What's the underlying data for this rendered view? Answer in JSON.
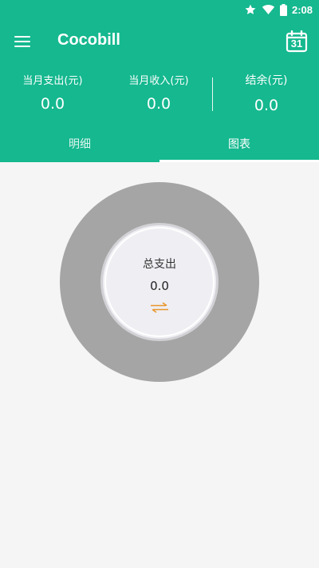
{
  "status_bar": {
    "time": "2:08",
    "icons": [
      "star-icon",
      "wifi-icon",
      "battery-icon"
    ]
  },
  "toolbar": {
    "title": "Cocobill",
    "menu_icon": "hamburger-menu-icon",
    "calendar_icon": "calendar-icon",
    "calendar_day": "31"
  },
  "summary": {
    "expense": {
      "label": "当月支出(元)",
      "value": "0.0"
    },
    "income": {
      "label": "当月收入(元)",
      "value": "0.0"
    },
    "balance": {
      "label": "结余(元)",
      "value": "0.0"
    }
  },
  "tabs": [
    {
      "label": "明细",
      "active": false
    },
    {
      "label": "图表",
      "active": true
    }
  ],
  "chart": {
    "center_label": "总支出",
    "center_value": "0.0",
    "swap_icon": "swap-arrows-icon"
  },
  "colors": {
    "primary": "#15b88f",
    "donut_ring": "#a5a5a5",
    "center_bg": "#efeef3",
    "swap_icon": "#e8962c",
    "background": "#f5f5f5"
  }
}
